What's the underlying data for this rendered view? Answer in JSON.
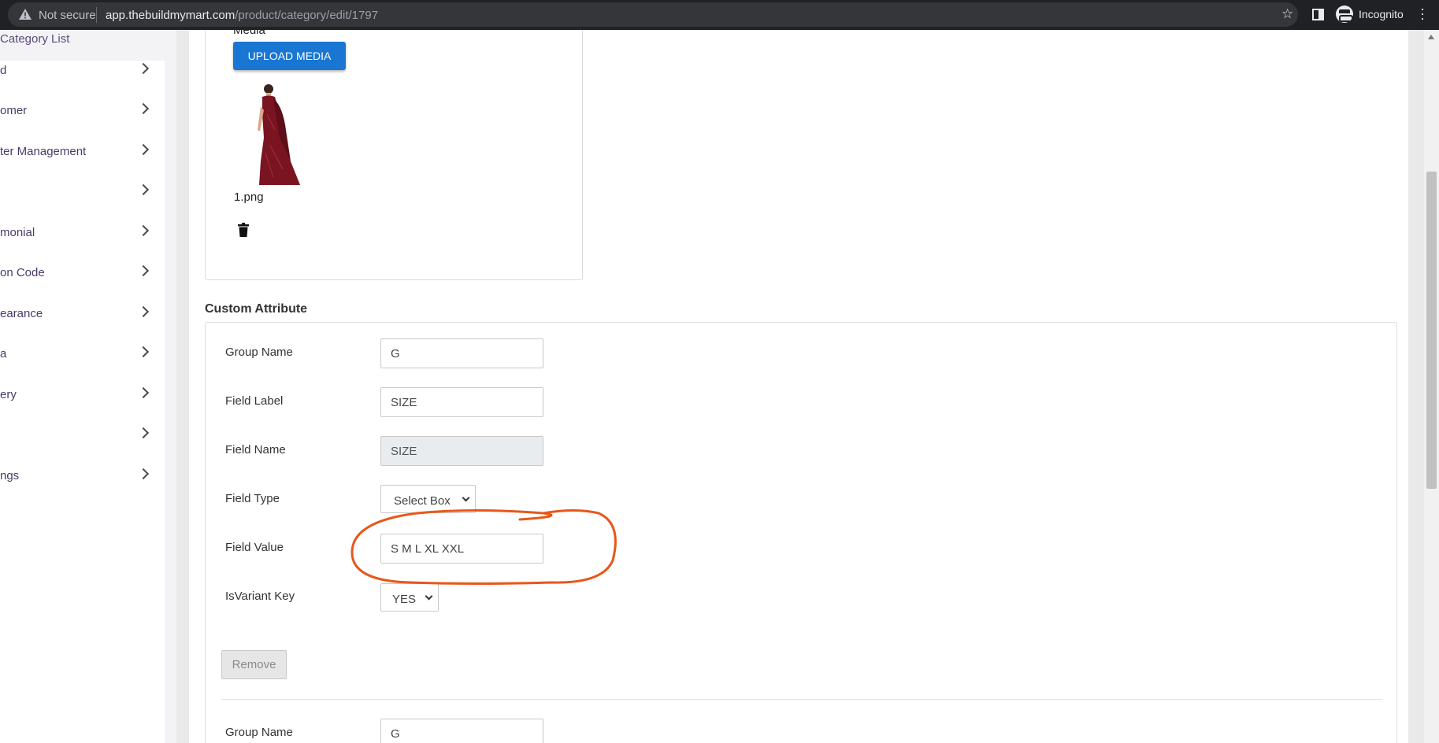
{
  "browser": {
    "security_label": "Not secure",
    "url_host": "app.thebuildmymart.com",
    "url_path": "/product/category/edit/1797",
    "profile_label": "Incognito",
    "icons": [
      "warning-icon",
      "star-icon",
      "side-panel-icon",
      "incognito-icon",
      "menu-icon"
    ]
  },
  "sidebar": {
    "active_item": "Category List",
    "items": [
      {
        "label": "d"
      },
      {
        "label": "omer"
      },
      {
        "label": "ter Management"
      },
      {
        "label": ""
      },
      {
        "label": "monial"
      },
      {
        "label": "on Code"
      },
      {
        "label": "earance"
      },
      {
        "label": "a"
      },
      {
        "label": "ery"
      },
      {
        "label": ""
      },
      {
        "label": "ngs"
      }
    ]
  },
  "media": {
    "heading": "Media",
    "upload_button": "UPLOAD MEDIA",
    "file_name": "1.png"
  },
  "custom_attribute": {
    "title": "Custom Attribute",
    "fields": {
      "group_name": {
        "label": "Group Name",
        "value": "G"
      },
      "field_label": {
        "label": "Field Label",
        "value": "SIZE"
      },
      "field_name": {
        "label": "Field Name",
        "value": "SIZE"
      },
      "field_type": {
        "label": "Field Type",
        "value": "Select Box"
      },
      "field_value": {
        "label": "Field Value",
        "value": "S M L XL XXL"
      },
      "is_variant_key": {
        "label": "IsVariant Key",
        "value": "YES"
      }
    },
    "remove_button": "Remove",
    "next_group": {
      "label": "Group Name",
      "value": "G"
    }
  },
  "colors": {
    "primary_button": "#1976d2",
    "annotation": "#e8571a",
    "saree": "#7a1420"
  }
}
